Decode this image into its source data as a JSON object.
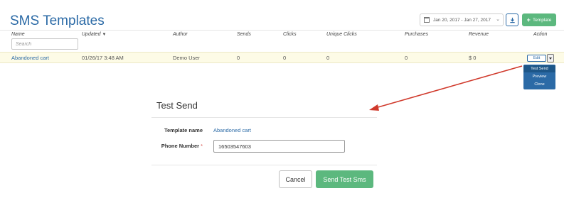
{
  "page": {
    "title": "SMS Templates"
  },
  "toolbar": {
    "date_range": "Jan 20, 2017 - Jan 27, 2017",
    "date_icon": "calendar-icon",
    "download_icon": "download-icon",
    "new_button_label": "Template",
    "new_button_icon": "plus-icon"
  },
  "table": {
    "columns": {
      "name": "Name",
      "updated": "Updated",
      "author": "Author",
      "sends": "Sends",
      "clicks": "Clicks",
      "unique_clicks": "Unique Clicks",
      "purchases": "Purchases",
      "revenue": "Revenue",
      "action": "Action"
    },
    "search_placeholder": "Search",
    "rows": [
      {
        "name": "Abandoned cart",
        "updated": "01/26/17 3:48 AM",
        "author": "Demo User",
        "sends": "0",
        "clicks": "0",
        "unique_clicks": "0",
        "purchases": "0",
        "revenue": "$ 0",
        "action_label": "Edit"
      }
    ]
  },
  "action_menu": {
    "items": [
      "Test Send",
      "Preview",
      "Clone"
    ],
    "selected": "Test Send"
  },
  "modal": {
    "title": "Test Send",
    "template_name_label": "Template name",
    "template_name_value": "Abandoned cart",
    "phone_label": "Phone Number",
    "required_mark": "*",
    "phone_value": "16503547603",
    "cancel_label": "Cancel",
    "submit_label": "Send Test Sms"
  },
  "colors": {
    "brand_blue": "#2b6aa6",
    "success_green": "#5cb87e",
    "annotation_red": "#d0392b",
    "highlight_row": "#fdfbe6"
  }
}
